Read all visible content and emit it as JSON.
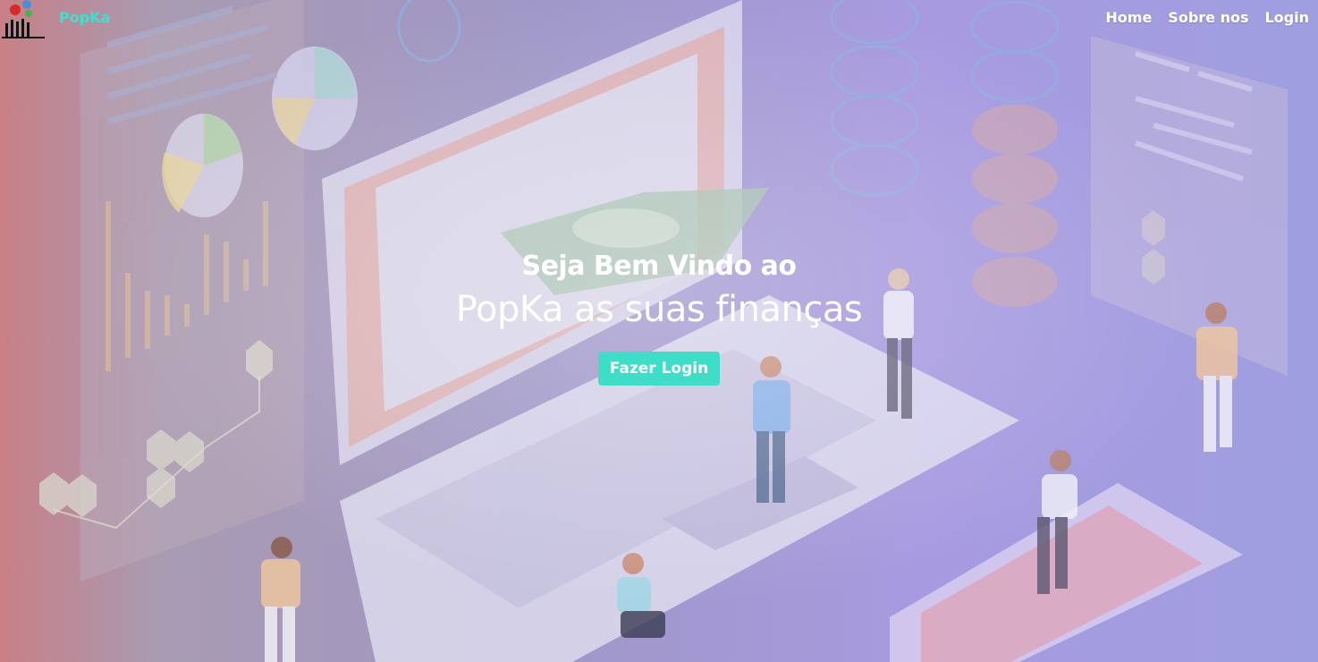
{
  "navbar": {
    "brand": "PopKa",
    "links": [
      "Home",
      "Sobre nos",
      "Login"
    ]
  },
  "hero": {
    "subtitle": "Seja Bem Vindo ao",
    "title": "PopKa as suas finanças",
    "cta_label": "Fazer Login"
  },
  "colors": {
    "accent": "#3fdcc8",
    "brand_text": "#3fe0d0"
  },
  "icons": [
    "logo-icon"
  ]
}
